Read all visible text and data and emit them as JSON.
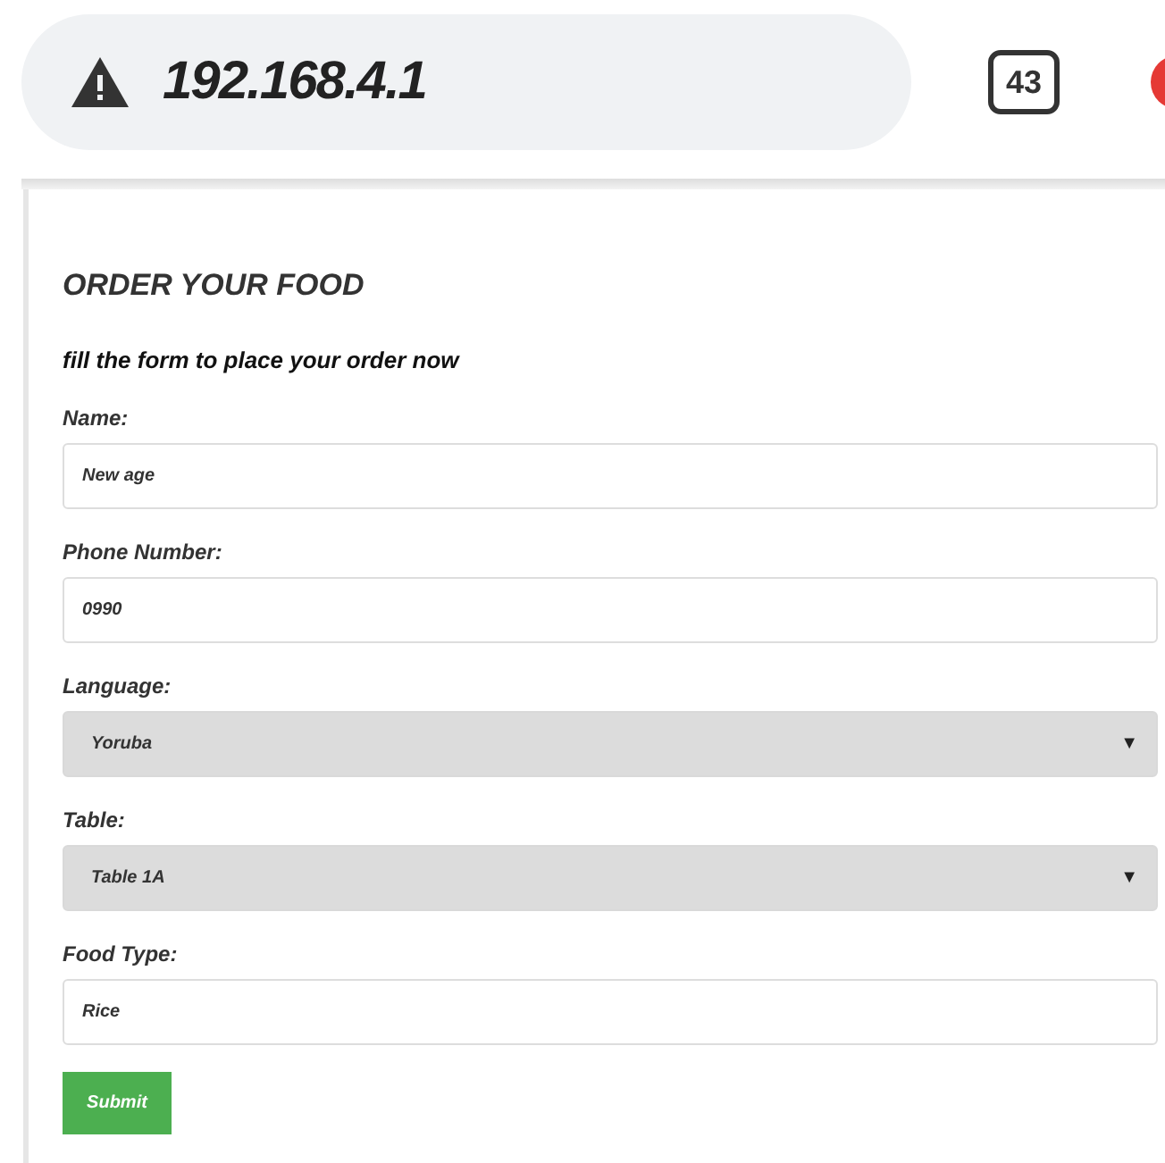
{
  "address_bar": {
    "url": "192.168.4.1"
  },
  "tab_count": "43",
  "form": {
    "title": "ORDER YOUR FOOD",
    "subtitle": "fill the form to place your order now",
    "fields": [
      {
        "kind": "text",
        "label": "Name:",
        "value": "New age"
      },
      {
        "kind": "text",
        "label": "Phone Number:",
        "value": "0990"
      },
      {
        "kind": "select",
        "label": "Language:",
        "value": "Yoruba",
        "arrow": "▼"
      },
      {
        "kind": "select",
        "label": "Table:",
        "value": "Table 1A",
        "arrow": "▼"
      },
      {
        "kind": "text",
        "label": "Food Type:",
        "value": "Rice"
      }
    ],
    "submit": "Submit"
  }
}
